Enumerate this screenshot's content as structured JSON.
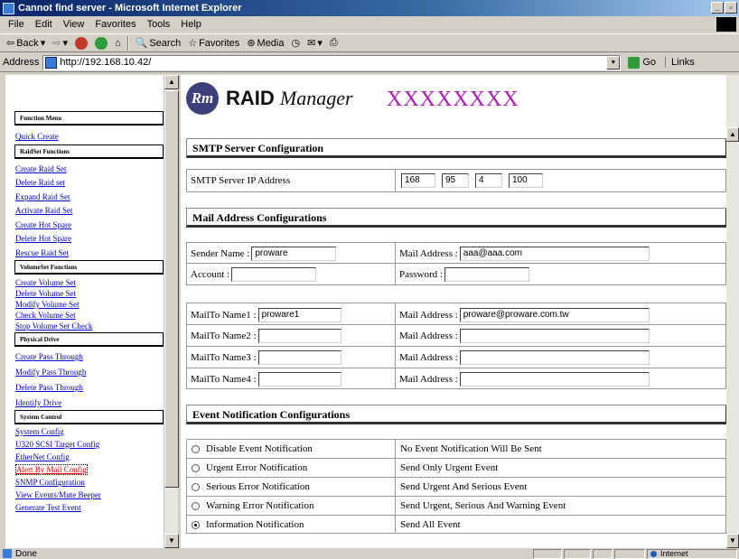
{
  "window": {
    "title": "Cannot find server - Microsoft Internet Explorer"
  },
  "menubar": [
    "File",
    "Edit",
    "View",
    "Favorites",
    "Tools",
    "Help"
  ],
  "toolbar": {
    "back": "Back",
    "search": "Search",
    "favorites": "Favorites",
    "media": "Media"
  },
  "address": {
    "label": "Address",
    "url": "http://192.168.10.42/",
    "go": "Go",
    "links": "Links"
  },
  "left_menu": {
    "function_menu": "Function Menu",
    "quick_create": "Quick Create",
    "raidset_functions": "RaidSet Functions",
    "raidset_links": [
      "Create Raid Set",
      "Delete Raid set",
      "Expand Raid Set",
      "Activate Raid Set",
      "Create Hot Spare",
      "Delete Hot Spare",
      "Rescue Raid Set"
    ],
    "volumeset_functions": "VolumeSet Functions",
    "volumeset_links": [
      "Create Volume Set",
      "Delete Volume Set",
      "Modify Volume Set",
      "Check Volume Set",
      "Stop Volume Set Check"
    ],
    "physical_drive": "Physical Drive",
    "physical_links": [
      "Create Pass Through",
      "Modify Pass Through",
      "Delete Pass Through",
      "Identify Drive"
    ],
    "system_controls": "System Control",
    "system_links": [
      "System Config",
      "U320 SCSI Target Config",
      "EtherNet Config",
      "Alert By Mail Config",
      "SNMP Configuration",
      "View Events/Mute Beeper",
      "Generate Test Event"
    ]
  },
  "header": {
    "logo_letter": "Rm",
    "app_name_part1": "RAID ",
    "app_name_part2": "Manager",
    "hostname": "XXXXXXXX"
  },
  "smtp": {
    "title": "SMTP Server Configuration",
    "ip_label": "SMTP Server IP Address",
    "ip": [
      "168",
      "95",
      "4",
      "100"
    ]
  },
  "mail": {
    "title": "Mail Address Configurations",
    "sender_label": "Sender Name :",
    "sender_value": "proware",
    "mail_label": "Mail Address :",
    "mail_value": "aaa@aaa.com",
    "account_label": "Account :",
    "account_value": "",
    "password_label": "Password :",
    "password_value": "",
    "recipients": [
      {
        "label": "MailTo Name1 :",
        "name": "proware1",
        "addr_label": "Mail Address :",
        "addr": "proware@proware.com.tw"
      },
      {
        "label": "MailTo Name2 :",
        "name": "",
        "addr_label": "Mail Address :",
        "addr": ""
      },
      {
        "label": "MailTo Name3 :",
        "name": "",
        "addr_label": "Mail Address :",
        "addr": ""
      },
      {
        "label": "MailTo Name4 :",
        "name": "",
        "addr_label": "Mail Address :",
        "addr": ""
      }
    ]
  },
  "events": {
    "title": "Event Notification Configurations",
    "options": [
      {
        "label": "Disable Event Notification",
        "desc": "No Event Notification Will Be Sent",
        "selected": false
      },
      {
        "label": "Urgent Error Notification",
        "desc": "Send Only Urgent Event",
        "selected": false
      },
      {
        "label": "Serious Error Notification",
        "desc": "Send Urgent And Serious Event",
        "selected": false
      },
      {
        "label": "Warning Error Notification",
        "desc": "Send Urgent, Serious And Warning Event",
        "selected": false
      },
      {
        "label": "Information Notification",
        "desc": "Send All Event",
        "selected": true
      }
    ]
  },
  "status": {
    "text": "Done",
    "zone": "Internet"
  }
}
